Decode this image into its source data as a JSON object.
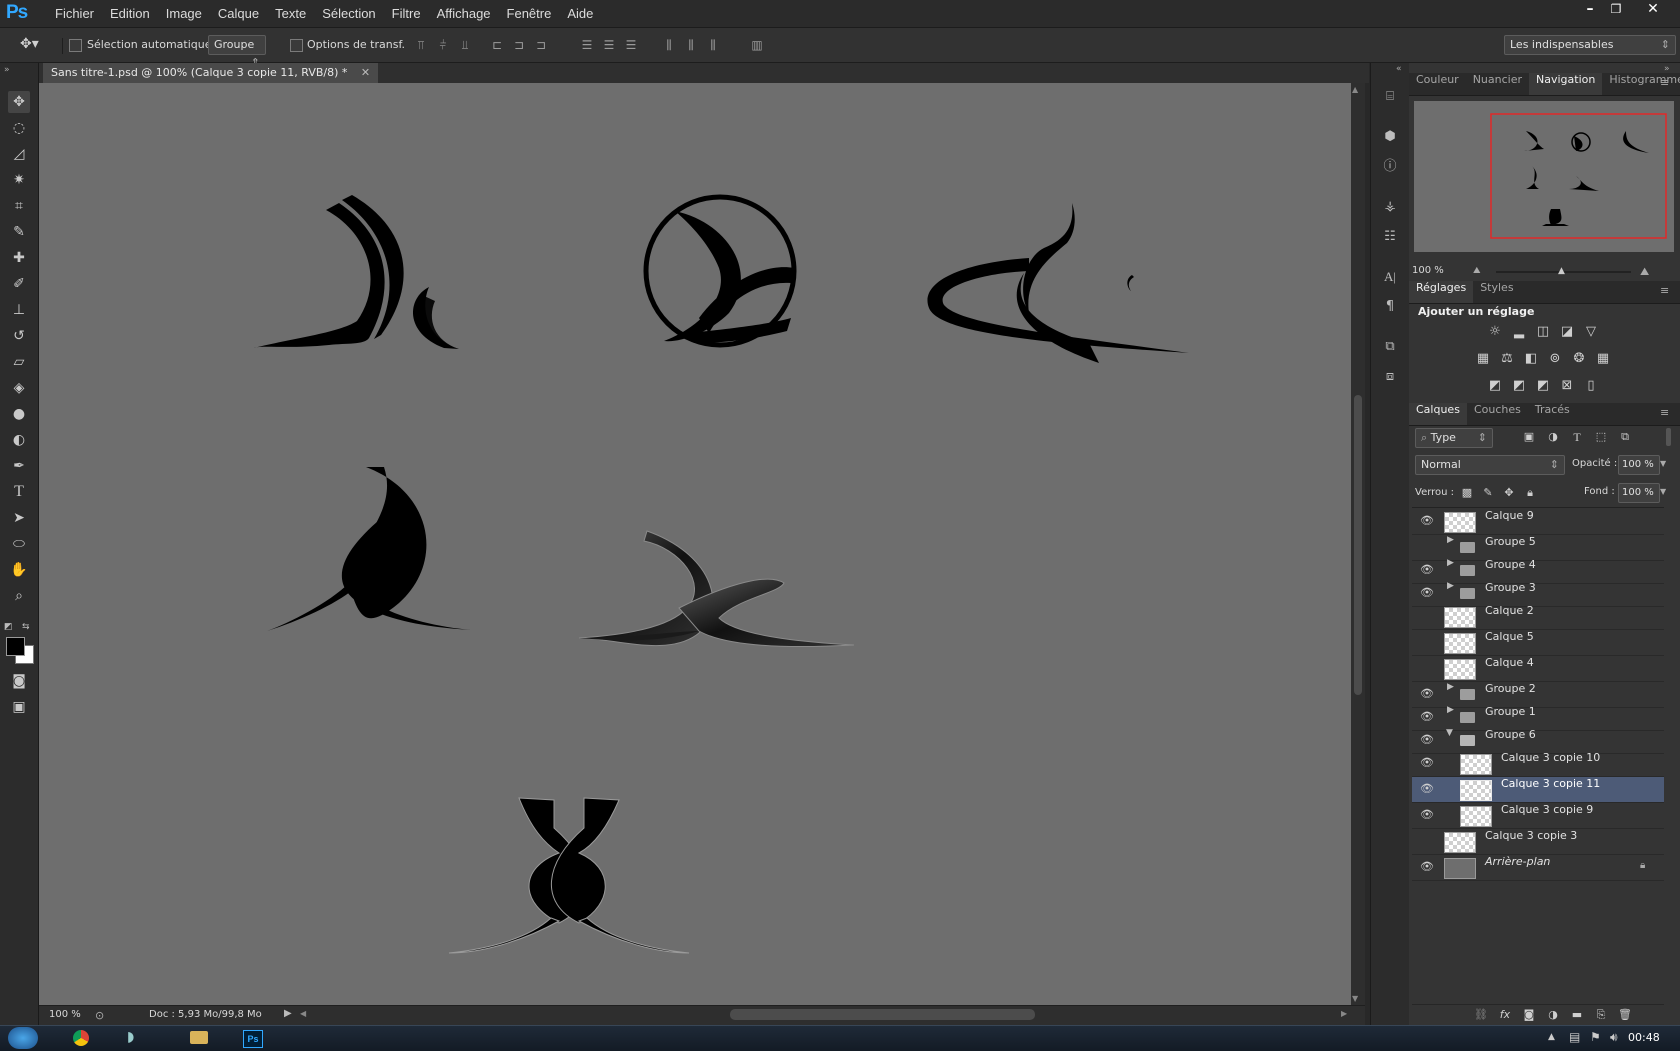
{
  "app": {
    "logo": "Ps",
    "menu": [
      "Fichier",
      "Edition",
      "Image",
      "Calque",
      "Texte",
      "Sélection",
      "Filtre",
      "Affichage",
      "Fenêtre",
      "Aide"
    ]
  },
  "options": {
    "auto_select_label": "Sélection automatique :",
    "auto_select_value": "Groupe",
    "transform_label": "Options de transf.",
    "workspace": "Les indispensables"
  },
  "document": {
    "tab_title": "Sans titre-1.psd @ 100% (Calque 3 copie 11, RVB/8) *",
    "zoom": "100 %",
    "doc_info": "Doc : 5,93 Mo/99,8 Mo"
  },
  "panels": {
    "top_tabs": [
      "Couleur",
      "Nuancier",
      "Navigation",
      "Histogramme"
    ],
    "top_active": "Navigation",
    "nav_zoom": "100 %",
    "adjust_tabs": [
      "Réglages",
      "Styles"
    ],
    "adjust_active": "Réglages",
    "adjust_title": "Ajouter un réglage",
    "layers_tabs": [
      "Calques",
      "Couches",
      "Tracés"
    ],
    "layers_active": "Calques",
    "filter_value": "Type",
    "blend_mode": "Normal",
    "opacity_label": "Opacité :",
    "opacity_value": "100 %",
    "lock_label": "Verrou :",
    "fill_label": "Fond :",
    "fill_value": "100 %"
  },
  "layers": [
    {
      "name": "Calque 9",
      "kind": "layer",
      "visible": true
    },
    {
      "name": "Groupe 5",
      "kind": "group",
      "visible": false
    },
    {
      "name": "Groupe 4",
      "kind": "group",
      "visible": true
    },
    {
      "name": "Groupe 3",
      "kind": "group",
      "visible": true
    },
    {
      "name": "Calque 2",
      "kind": "layer",
      "visible": false
    },
    {
      "name": "Calque 5",
      "kind": "layer",
      "visible": false
    },
    {
      "name": "Calque 4",
      "kind": "layer",
      "visible": false
    },
    {
      "name": "Groupe 2",
      "kind": "group",
      "visible": true
    },
    {
      "name": "Groupe 1",
      "kind": "group",
      "visible": true
    },
    {
      "name": "Groupe 6",
      "kind": "group-open",
      "visible": true
    },
    {
      "name": "Calque 3 copie 10",
      "kind": "child",
      "visible": true
    },
    {
      "name": "Calque 3 copie 11",
      "kind": "child",
      "visible": true,
      "selected": true
    },
    {
      "name": "Calque 3 copie 9",
      "kind": "child",
      "visible": true
    },
    {
      "name": "Calque 3 copie 3",
      "kind": "layer",
      "visible": false
    },
    {
      "name": "Arrière-plan",
      "kind": "background",
      "visible": true
    }
  ],
  "taskbar": {
    "time": "00:48"
  }
}
